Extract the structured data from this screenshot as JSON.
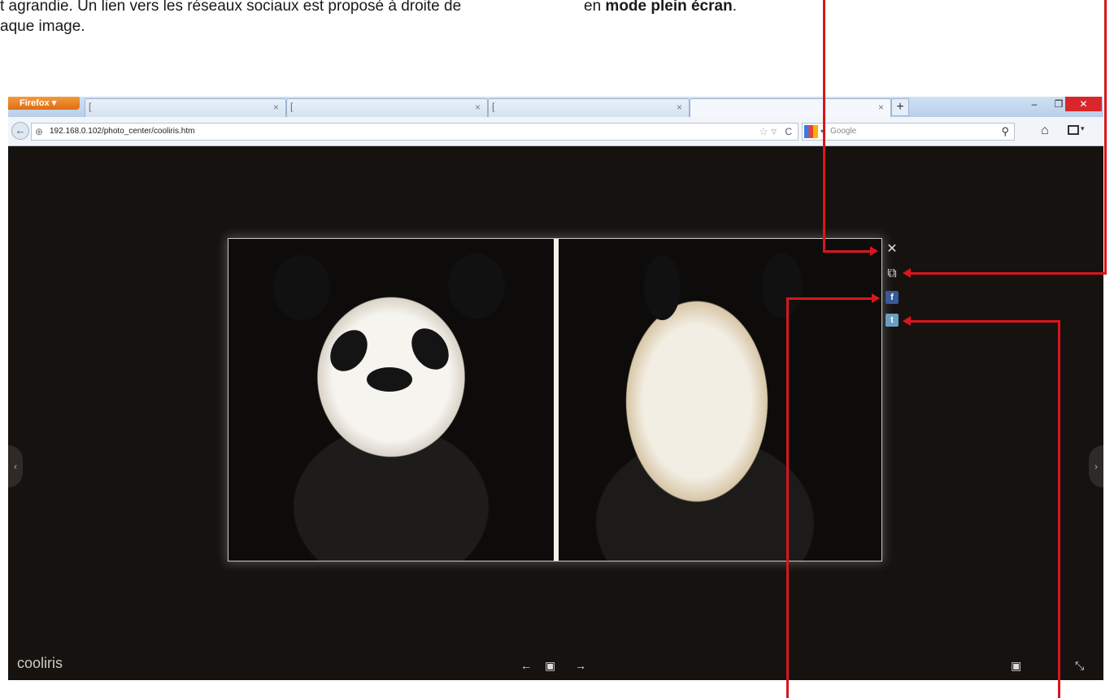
{
  "document": {
    "line1_text": "t agrandie. Un lien vers les réseaux sociaux est proposé à droite de",
    "line2_text": "aque image.",
    "right_prefix": "en ",
    "right_bold": "mode plein écran",
    "right_suffix": "."
  },
  "browser": {
    "app_button": "Firefox ▾",
    "tabs": [
      {
        "label": "[",
        "close": "×"
      },
      {
        "label": "[",
        "close": "×"
      },
      {
        "label": "[",
        "close": "×"
      },
      {
        "label": "",
        "close": "×"
      }
    ],
    "new_tab": "+",
    "window_controls": {
      "minimize": "–",
      "restore": "❐",
      "close": "✕"
    },
    "url": "192.168.0.102/photo_center/cooliris.htm",
    "search_placeholder": "Google"
  },
  "viewer": {
    "logo": "cooliris",
    "side_buttons": [
      "close-icon",
      "external-link-icon",
      "facebook-icon",
      "twitter-icon"
    ],
    "social_labels": {
      "facebook": "f",
      "twitter": "t"
    },
    "controls": {
      "prev": "←",
      "slideshow": "▣",
      "next": "→",
      "screen": "▣",
      "fullscreen": "⤡"
    },
    "nav_prev": "‹",
    "nav_next": "›"
  },
  "colors": {
    "annotation": "#d9161c",
    "viewer_bg": "#151210",
    "firefox": "#e8782a"
  }
}
